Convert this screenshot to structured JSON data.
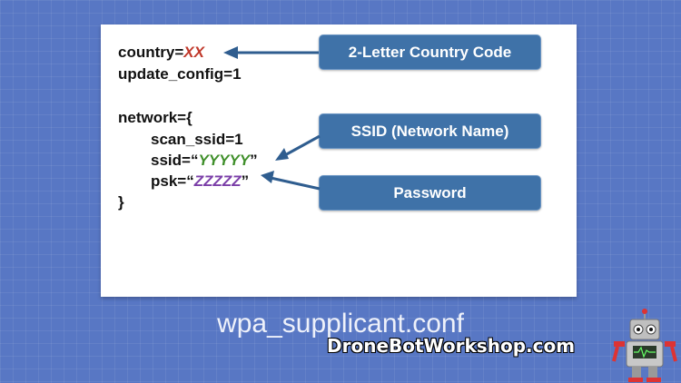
{
  "config": {
    "country_key": "country=",
    "country_value": "XX",
    "update_config": "update_config=1",
    "network_open": "network={",
    "scan_ssid": "scan_ssid=1",
    "ssid_key": "ssid=“",
    "ssid_value": "YYYYY",
    "ssid_close": "”",
    "psk_key": "psk=“",
    "psk_value": "ZZZZZ",
    "psk_close": "”",
    "network_close": "}"
  },
  "labels": {
    "country": "2-Letter Country Code",
    "ssid": "SSID (Network Name)",
    "password": "Password"
  },
  "filename": "wpa_supplicant.conf",
  "brand": "DroneBotWorkshop.com",
  "colors": {
    "background": "#5877c4",
    "label_box": "#3f72a8",
    "country_value": "#c0392b",
    "ssid_value": "#3f8f2a",
    "psk_value": "#7b3fa8"
  }
}
